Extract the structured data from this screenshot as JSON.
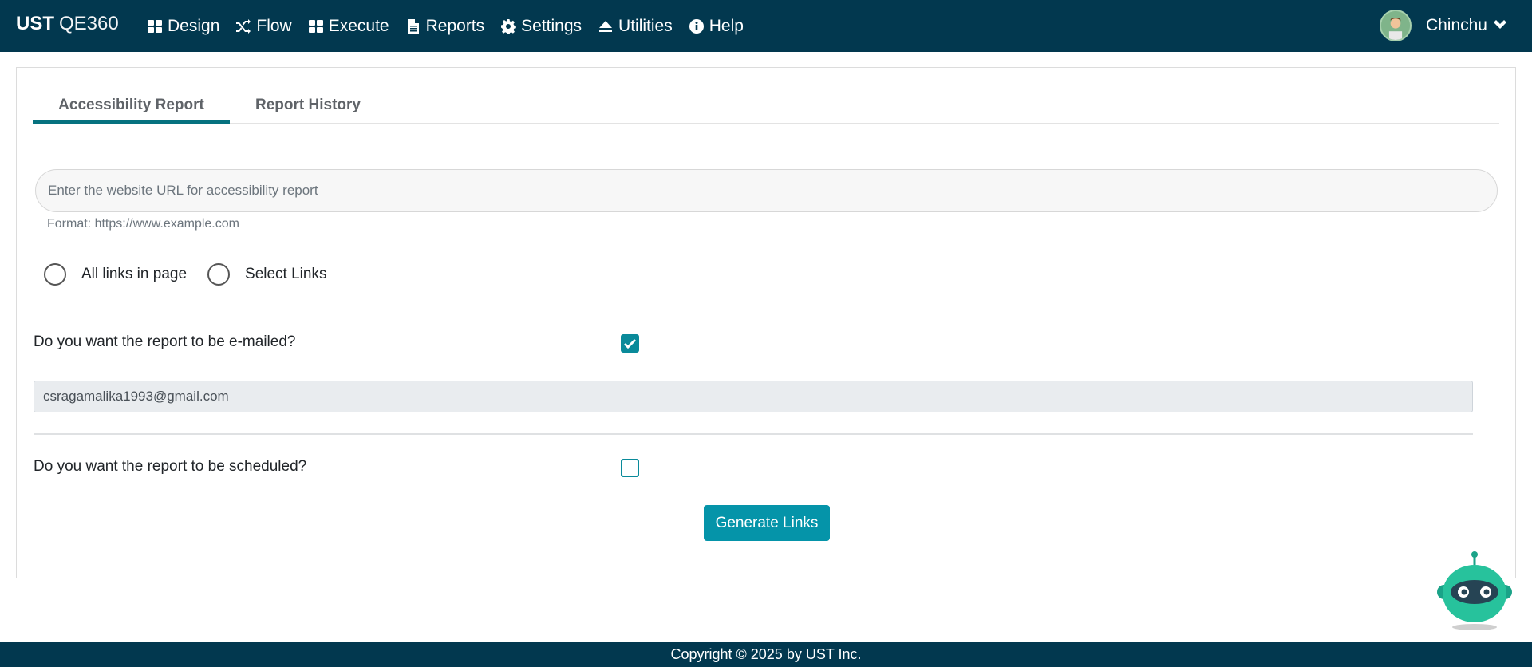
{
  "brand": {
    "bold": "UST",
    "light": "QE360"
  },
  "nav": {
    "items": [
      {
        "label": "Design",
        "icon": "grid-icon"
      },
      {
        "label": "Flow",
        "icon": "shuffle-icon"
      },
      {
        "label": "Execute",
        "icon": "grid-icon"
      },
      {
        "label": "Reports",
        "icon": "document-icon"
      },
      {
        "label": "Settings",
        "icon": "gear-icon"
      },
      {
        "label": "Utilities",
        "icon": "eject-icon"
      },
      {
        "label": "Help",
        "icon": "info-icon"
      }
    ],
    "user_name": "Chinchu"
  },
  "tabs": [
    {
      "label": "Accessibility Report",
      "active": true
    },
    {
      "label": "Report History",
      "active": false
    }
  ],
  "form": {
    "url_placeholder": "Enter the website URL for accessibility report",
    "url_value": "",
    "hint": "Format: https://www.example.com",
    "radio_all": "All links in page",
    "radio_select": "Select Links",
    "email_question": "Do you want the report to be e-mailed?",
    "email_checked": true,
    "email_value": "csragamalika1993@gmail.com",
    "schedule_question": "Do you want the report to be scheduled?",
    "schedule_checked": false,
    "generate_label": "Generate Links"
  },
  "footer": {
    "text": "Copyright © 2025 by UST Inc."
  },
  "colors": {
    "navbar": "#02384f",
    "accent": "#0594a9",
    "tab_underline": "#06727f"
  }
}
